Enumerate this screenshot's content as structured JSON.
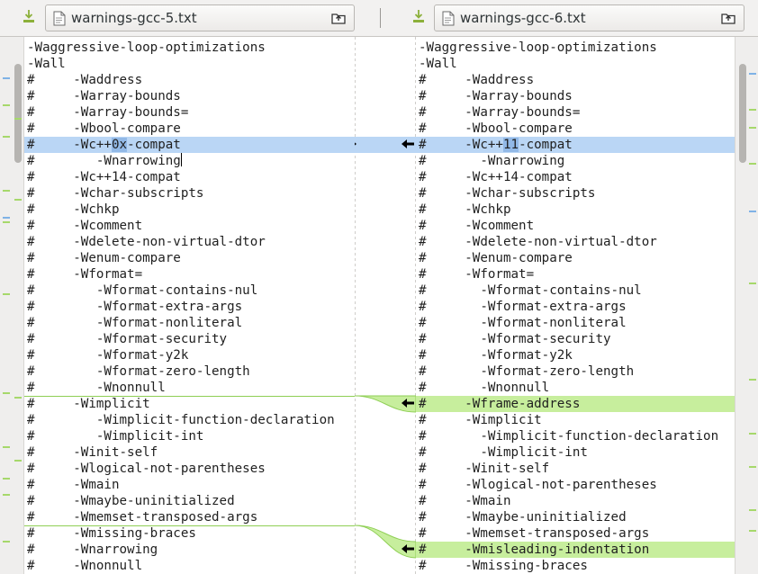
{
  "left_file": {
    "name": "warnings-gcc-5.txt"
  },
  "right_file": {
    "name": "warnings-gcc-6.txt"
  },
  "left_lines": [
    "-Waggressive-loop-optimizations",
    "-Wall",
    "#     -Waddress",
    "#     -Warray-bounds",
    "#     -Warray-bounds=",
    "#     -Wbool-compare",
    "#     -Wc++0x-compat",
    "#        -Wnarrowing",
    "#     -Wc++14-compat",
    "#     -Wchar-subscripts",
    "#     -Wchkp",
    "#     -Wcomment",
    "#     -Wdelete-non-virtual-dtor",
    "#     -Wenum-compare",
    "#     -Wformat=",
    "#        -Wformat-contains-nul",
    "#        -Wformat-extra-args",
    "#        -Wformat-nonliteral",
    "#        -Wformat-security",
    "#        -Wformat-y2k",
    "#        -Wformat-zero-length",
    "#        -Wnonnull",
    "#     -Wimplicit",
    "#        -Wimplicit-function-declaration",
    "#        -Wimplicit-int",
    "#     -Winit-self",
    "#     -Wlogical-not-parentheses",
    "#     -Wmain",
    "#     -Wmaybe-uninitialized",
    "#     -Wmemset-transposed-args",
    "#     -Wmissing-braces",
    "#     -Wnarrowing",
    "#     -Wnonnull"
  ],
  "right_lines": [
    "-Waggressive-loop-optimizations",
    "-Wall",
    "#     -Waddress",
    "#     -Warray-bounds",
    "#     -Warray-bounds=",
    "#     -Wbool-compare",
    "#     -Wc++11-compat",
    "#       -Wnarrowing",
    "#     -Wc++14-compat",
    "#     -Wchar-subscripts",
    "#     -Wchkp",
    "#     -Wcomment",
    "#     -Wdelete-non-virtual-dtor",
    "#     -Wenum-compare",
    "#     -Wformat=",
    "#       -Wformat-contains-nul",
    "#       -Wformat-extra-args",
    "#       -Wformat-nonliteral",
    "#       -Wformat-security",
    "#       -Wformat-y2k",
    "#       -Wformat-zero-length",
    "#       -Wnonnull",
    "#     -Wframe-address",
    "#     -Wimplicit",
    "#       -Wimplicit-function-declaration",
    "#       -Wimplicit-int",
    "#     -Winit-self",
    "#     -Wlogical-not-parentheses",
    "#     -Wmain",
    "#     -Wmaybe-uninitialized",
    "#     -Wmemset-transposed-args",
    "#     -Wmisleading-indentation",
    "#     -Wmissing-braces"
  ],
  "colors": {
    "changed_line": "#bad6f5",
    "changed_word": "#92b9e7",
    "inserted_line": "#c7ee9d",
    "inserted_border": "#8fcf55",
    "save_icon": "#8cb03a"
  },
  "icons": {
    "save": "save-document-icon",
    "document": "text-document-icon",
    "open": "open-folder-icon",
    "push_right": "arrow-right-icon",
    "push_left": "arrow-left-icon"
  }
}
